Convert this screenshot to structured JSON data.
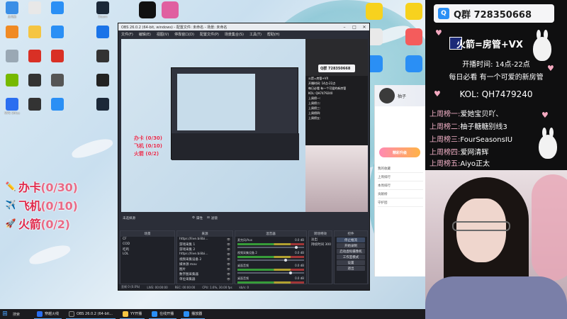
{
  "desktop": {
    "icons": [
      {
        "label": "此电脑",
        "icon": "computer-icon",
        "color": "#3a8ee6"
      },
      {
        "label": "",
        "icon": "file-icon",
        "color": "#e8e8e8"
      },
      {
        "label": "",
        "icon": "qq-icon",
        "color": "#2a8ff5"
      },
      {
        "label": "Steam",
        "icon": "steam-icon",
        "color": "#1b2838"
      },
      {
        "label": "",
        "icon": "app-icon",
        "color": "#f08a24"
      },
      {
        "label": "",
        "icon": "folder-icon",
        "color": "#f5c542"
      },
      {
        "label": "",
        "icon": "app-icon",
        "color": "#2a8ff5"
      },
      {
        "label": "",
        "icon": "app-icon",
        "color": "#1a73e8"
      },
      {
        "label": "",
        "icon": "recycle-bin-icon",
        "color": "#9aa8b4"
      },
      {
        "label": "",
        "icon": "game-icon",
        "color": "#d93025"
      },
      {
        "label": "",
        "icon": "record-icon",
        "color": "#d93025"
      },
      {
        "label": "",
        "icon": "pirate-icon",
        "color": "#333333"
      },
      {
        "label": "",
        "icon": "nvidia-icon",
        "color": "#76b900"
      },
      {
        "label": "",
        "icon": "app-icon",
        "color": "#333333"
      },
      {
        "label": "",
        "icon": "app-icon",
        "color": "#555555"
      },
      {
        "label": "",
        "icon": "obs-icon",
        "color": "#222222"
      },
      {
        "label": "WPS Office",
        "icon": "wps-icon",
        "color": "#2a6ef0"
      },
      {
        "label": "",
        "icon": "app-icon",
        "color": "#333333"
      },
      {
        "label": "",
        "icon": "user-icon",
        "color": "#2a8ff5"
      },
      {
        "label": "",
        "icon": "app-icon",
        "color": "#1b2838"
      }
    ],
    "goals": [
      {
        "icon": "pencil-icon",
        "text": "办卡",
        "count": "(0/30)"
      },
      {
        "icon": "plane-icon",
        "text": "飞机",
        "count": "(0/10)"
      },
      {
        "icon": "rocket-icon",
        "text": "火箭",
        "count": "(0/2)"
      }
    ]
  },
  "taskbar": {
    "search": "搜索",
    "items": [
      {
        "label": "穿越火线",
        "color": "#2a6ef0"
      },
      {
        "label": "OBS 26.0.2 (64-bit...",
        "color": "#222222"
      },
      {
        "label": "YY开播",
        "color": "#f5c542"
      },
      {
        "label": "在线开播",
        "color": "#2a8ff5"
      },
      {
        "label": "播放器",
        "color": "#2a8ff5"
      }
    ]
  },
  "obs": {
    "title": "OBS 26.0.2 (64-bit, windows) - 配置文件: 未命名 - 场景: 未命名",
    "menu": [
      "文件(F)",
      "编辑(E)",
      "视图(V)",
      "停靠窗口(D)",
      "配置文件(P)",
      "场景集合(S)",
      "工具(T)",
      "帮助(H)"
    ],
    "preview": {
      "qq": "Q群 728350668",
      "info_lines": [
        "火箭=房管+VX",
        "开播时间: 14点-22点",
        "每日必看 有一个可爱的新房管",
        "KOL: QH7479240",
        "上周榜一:",
        "上周榜二:",
        "上周榜三:",
        "上周榜四:",
        "上周榜五:"
      ],
      "goals": [
        "办卡 (0/30)",
        "飞机 (0/10)",
        "火箭 (0/2)"
      ]
    },
    "source_label": "未选择源",
    "source_props": "属性",
    "source_filters": "滤镜",
    "panels": {
      "scenes": {
        "title": "场景",
        "items": [
          "CF",
          "COD",
          "吃鸡",
          "LOL"
        ]
      },
      "sources": {
        "title": "来源",
        "items": [
          "https://live.bilibi...",
          "游戏采集 1",
          "游戏采集 2",
          "https://live.bilibi...",
          "视频采集设备 2",
          "媒体源 mov",
          "图片",
          "数字图采集器",
          "单位采集器"
        ]
      },
      "mixer": {
        "title": "混音器",
        "channels": [
          {
            "name": "麦克风/Aux",
            "db": "0.0 dB",
            "level": 0.88
          },
          {
            "name": "视频采集设备 2",
            "db": "0.0 dB",
            "level": 0.72
          },
          {
            "name": "桌面音频",
            "db": "0.0 dB",
            "level": 0.8
          },
          {
            "name": "桌面音频",
            "db": "0.0 dB",
            "level": 0.65
          }
        ]
      },
      "transitions": {
        "title": "转场特效",
        "items": [
          "淡出",
          "持续时间 300 ms"
        ]
      },
      "controls": {
        "title": "控件",
        "buttons": [
          "停止推流",
          "开始录制",
          "启动虚拟摄像机",
          "工作室模式",
          "设置",
          "退出"
        ]
      }
    },
    "status": [
      "丢帧 0 (0.0%)",
      "LIVE: 00:00:00",
      "REC: 00:00:00",
      "CPU: 1.6%, 30.00 fps",
      "kb/s: 0"
    ]
  },
  "chatwin": {
    "name": "柚子",
    "button": "精彩升级",
    "items": [
      "我的收藏",
      "上周排行",
      "本周排行",
      "贡献榜",
      "守护团"
    ]
  },
  "overlay": {
    "qq": "Q群 728350668",
    "title": "火箭=房管+VX",
    "hours": "开播时间: 14点-22点",
    "motto": "每日必看 有一个可爱的新房管",
    "kol": "KOL: QH7479240",
    "ranks": [
      {
        "k": "上周榜一:",
        "v": "爱她宝贝吖、"
      },
      {
        "k": "上周榜二:",
        "v": "柚子糖糖别线3"
      },
      {
        "k": "上周榜三:",
        "v": "FourSeasonsIU"
      },
      {
        "k": "上周榜四:",
        "v": "爱网清辉"
      },
      {
        "k": "上周榜五:",
        "v": "Aiyo正太"
      }
    ]
  },
  "colors": {
    "accent": "#e02a4c",
    "obs_bg": "#2b2e38",
    "overlay_bg": "#0f0f10"
  }
}
